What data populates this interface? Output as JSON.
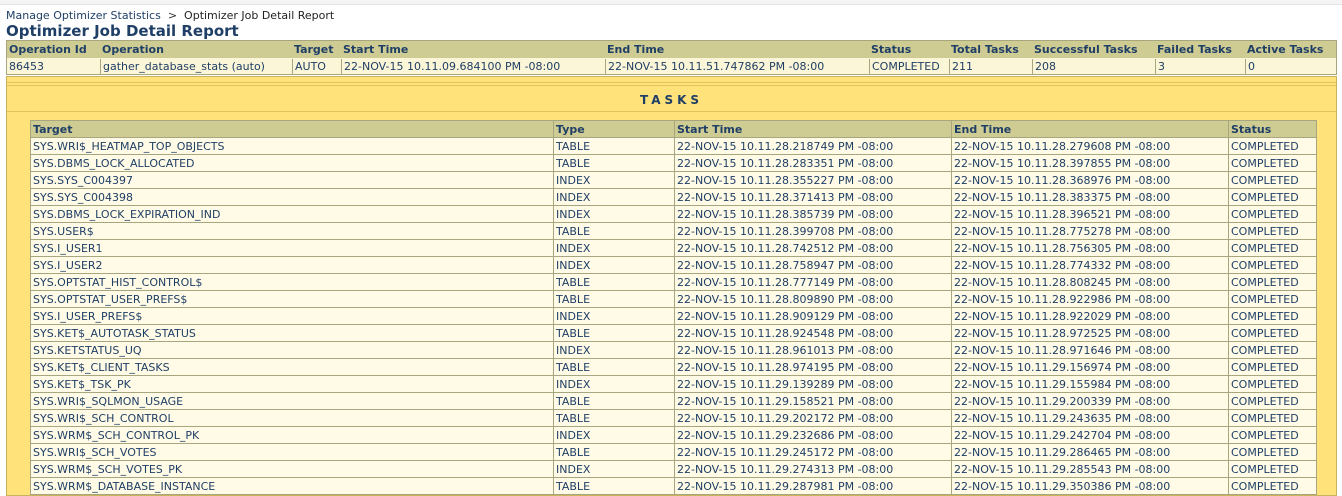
{
  "breadcrumb": {
    "parent": "Manage Optimizer Statistics",
    "separator": ">",
    "current": "Optimizer Job Detail Report"
  },
  "page_title": "Optimizer Job Detail Report",
  "operation": {
    "headers": {
      "operation_id": "Operation Id",
      "operation": "Operation",
      "target": "Target",
      "start_time": "Start Time",
      "end_time": "End Time",
      "status": "Status",
      "total_tasks": "Total Tasks",
      "successful_tasks": "Successful Tasks",
      "failed_tasks": "Failed Tasks",
      "active_tasks": "Active Tasks"
    },
    "values": {
      "operation_id": "86453",
      "operation": "gather_database_stats (auto)",
      "target": "AUTO",
      "start_time": "22-NOV-15 10.11.09.684100 PM -08:00",
      "end_time": "22-NOV-15 10.11.51.747862 PM -08:00",
      "status": "COMPLETED",
      "total_tasks": "211",
      "successful_tasks": "208",
      "failed_tasks": "3",
      "active_tasks": "0"
    }
  },
  "tasks": {
    "title": "TASKS",
    "columns": [
      "Target",
      "Type",
      "Start Time",
      "End Time",
      "Status"
    ],
    "rows": [
      [
        "SYS.WRI$_HEATMAP_TOP_OBJECTS",
        "TABLE",
        "22-NOV-15 10.11.28.218749 PM -08:00",
        "22-NOV-15 10.11.28.279608 PM -08:00",
        "COMPLETED"
      ],
      [
        "SYS.DBMS_LOCK_ALLOCATED",
        "TABLE",
        "22-NOV-15 10.11.28.283351 PM -08:00",
        "22-NOV-15 10.11.28.397855 PM -08:00",
        "COMPLETED"
      ],
      [
        "SYS.SYS_C004397",
        "INDEX",
        "22-NOV-15 10.11.28.355227 PM -08:00",
        "22-NOV-15 10.11.28.368976 PM -08:00",
        "COMPLETED"
      ],
      [
        "SYS.SYS_C004398",
        "INDEX",
        "22-NOV-15 10.11.28.371413 PM -08:00",
        "22-NOV-15 10.11.28.383375 PM -08:00",
        "COMPLETED"
      ],
      [
        "SYS.DBMS_LOCK_EXPIRATION_IND",
        "INDEX",
        "22-NOV-15 10.11.28.385739 PM -08:00",
        "22-NOV-15 10.11.28.396521 PM -08:00",
        "COMPLETED"
      ],
      [
        "SYS.USER$",
        "TABLE",
        "22-NOV-15 10.11.28.399708 PM -08:00",
        "22-NOV-15 10.11.28.775278 PM -08:00",
        "COMPLETED"
      ],
      [
        "SYS.I_USER1",
        "INDEX",
        "22-NOV-15 10.11.28.742512 PM -08:00",
        "22-NOV-15 10.11.28.756305 PM -08:00",
        "COMPLETED"
      ],
      [
        "SYS.I_USER2",
        "INDEX",
        "22-NOV-15 10.11.28.758947 PM -08:00",
        "22-NOV-15 10.11.28.774332 PM -08:00",
        "COMPLETED"
      ],
      [
        "SYS.OPTSTAT_HIST_CONTROL$",
        "TABLE",
        "22-NOV-15 10.11.28.777149 PM -08:00",
        "22-NOV-15 10.11.28.808245 PM -08:00",
        "COMPLETED"
      ],
      [
        "SYS.OPTSTAT_USER_PREFS$",
        "TABLE",
        "22-NOV-15 10.11.28.809890 PM -08:00",
        "22-NOV-15 10.11.28.922986 PM -08:00",
        "COMPLETED"
      ],
      [
        "SYS.I_USER_PREFS$",
        "INDEX",
        "22-NOV-15 10.11.28.909129 PM -08:00",
        "22-NOV-15 10.11.28.922029 PM -08:00",
        "COMPLETED"
      ],
      [
        "SYS.KET$_AUTOTASK_STATUS",
        "TABLE",
        "22-NOV-15 10.11.28.924548 PM -08:00",
        "22-NOV-15 10.11.28.972525 PM -08:00",
        "COMPLETED"
      ],
      [
        "SYS.KETSTATUS_UQ",
        "INDEX",
        "22-NOV-15 10.11.28.961013 PM -08:00",
        "22-NOV-15 10.11.28.971646 PM -08:00",
        "COMPLETED"
      ],
      [
        "SYS.KET$_CLIENT_TASKS",
        "TABLE",
        "22-NOV-15 10.11.28.974195 PM -08:00",
        "22-NOV-15 10.11.29.156974 PM -08:00",
        "COMPLETED"
      ],
      [
        "SYS.KET$_TSK_PK",
        "INDEX",
        "22-NOV-15 10.11.29.139289 PM -08:00",
        "22-NOV-15 10.11.29.155984 PM -08:00",
        "COMPLETED"
      ],
      [
        "SYS.WRI$_SQLMON_USAGE",
        "TABLE",
        "22-NOV-15 10.11.29.158521 PM -08:00",
        "22-NOV-15 10.11.29.200339 PM -08:00",
        "COMPLETED"
      ],
      [
        "SYS.WRI$_SCH_CONTROL",
        "TABLE",
        "22-NOV-15 10.11.29.202172 PM -08:00",
        "22-NOV-15 10.11.29.243635 PM -08:00",
        "COMPLETED"
      ],
      [
        "SYS.WRM$_SCH_CONTROL_PK",
        "INDEX",
        "22-NOV-15 10.11.29.232686 PM -08:00",
        "22-NOV-15 10.11.29.242704 PM -08:00",
        "COMPLETED"
      ],
      [
        "SYS.WRI$_SCH_VOTES",
        "TABLE",
        "22-NOV-15 10.11.29.245172 PM -08:00",
        "22-NOV-15 10.11.29.286465 PM -08:00",
        "COMPLETED"
      ],
      [
        "SYS.WRM$_SCH_VOTES_PK",
        "INDEX",
        "22-NOV-15 10.11.29.274313 PM -08:00",
        "22-NOV-15 10.11.29.285543 PM -08:00",
        "COMPLETED"
      ],
      [
        "SYS.WRM$_DATABASE_INSTANCE",
        "TABLE",
        "22-NOV-15 10.11.29.287981 PM -08:00",
        "22-NOV-15 10.11.29.350386 PM -08:00",
        "COMPLETED"
      ]
    ]
  }
}
